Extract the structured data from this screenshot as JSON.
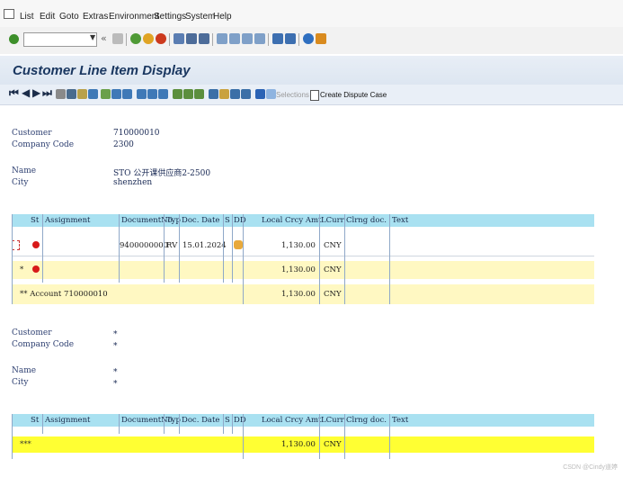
{
  "menubar": {
    "items": [
      "List",
      "Edit",
      "Goto",
      "Extras",
      "Environment",
      "Settings",
      "System",
      "Help"
    ]
  },
  "title": "Customer Line Item Display",
  "app_toolbar": {
    "selections": "Selections",
    "dispute": "Create Dispute Case"
  },
  "header1": {
    "customer_label": "Customer",
    "customer": "710000010",
    "company_label": "Company Code",
    "company": "2300",
    "name_label": "Name",
    "name": "STO 公开课供应商2-2500",
    "city_label": "City",
    "city": "shenzhen"
  },
  "columns": [
    "St",
    "Assignment",
    "DocumentNo",
    "Typ",
    "Doc. Date",
    "S",
    "DD",
    "Local Crcy Amt",
    "LCurr",
    "Clrng doc.",
    "Text"
  ],
  "table1": {
    "row1": {
      "docno": "9400000000",
      "typ": "RV",
      "date": "15.01.2024",
      "amt": "1,130.00",
      "curr": "CNY"
    },
    "row2": {
      "marker": "*",
      "amt": "1,130.00",
      "curr": "CNY"
    },
    "row3": {
      "label": "** Account 710000010",
      "amt": "1,130.00",
      "curr": "CNY"
    }
  },
  "header2": {
    "customer_label": "Customer",
    "customer": "*",
    "company_label": "Company Code",
    "company": "*",
    "name_label": "Name",
    "name": "*",
    "city_label": "City",
    "city": "*"
  },
  "table2": {
    "total": {
      "label": "***",
      "amt": "1,130.00",
      "curr": "CNY"
    }
  },
  "footer": "CSDN @Cindy道婷"
}
